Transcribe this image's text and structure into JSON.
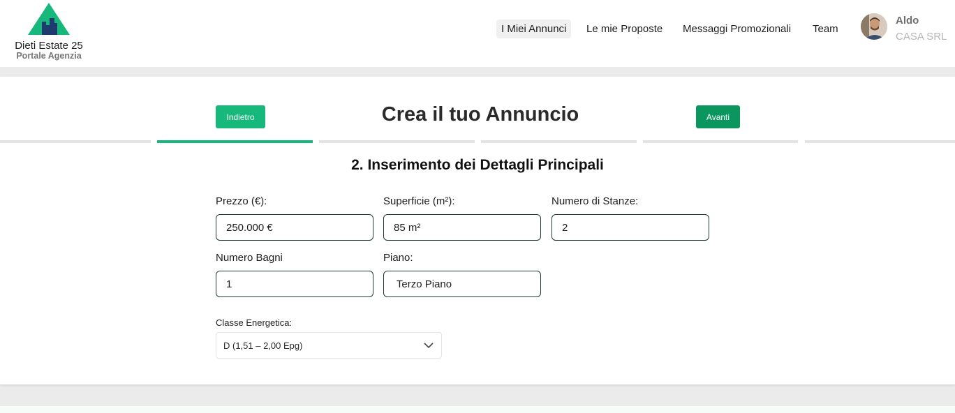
{
  "brand": {
    "name": "Dieti Estate 25",
    "subtitle": "Portale Agenzia",
    "colors": {
      "primary": "#16b87c",
      "primary_dark": "#0b9660",
      "building": "#1f3a6e"
    }
  },
  "nav": {
    "items": [
      {
        "label": "I Miei Annunci",
        "active": true
      },
      {
        "label": "Le mie Proposte",
        "active": false
      },
      {
        "label": "Messaggi Promozionali",
        "active": false
      },
      {
        "label": "Team",
        "active": false
      }
    ]
  },
  "user": {
    "name": "Aldo",
    "company": "CASA SRL"
  },
  "wizard": {
    "title": "Crea il tuo Annuncio",
    "back_label": "Indietro",
    "next_label": "Avanti",
    "current_step": 2,
    "total_steps": 6,
    "step_title": "2. Inserimento dei Dettagli Principali"
  },
  "form": {
    "price": {
      "label": "Prezzo (€):",
      "value": "250.000 €"
    },
    "surface": {
      "label": "Superficie (m²):",
      "value": "85 m²"
    },
    "rooms": {
      "label": "Numero di Stanze:",
      "value": "2"
    },
    "bathrooms": {
      "label": "Numero Bagni",
      "value": "1"
    },
    "floor": {
      "label": "Piano:",
      "value": " Terzo Piano"
    },
    "energy_class": {
      "label": "Classe Energetica:",
      "value": "D  (1,51 – 2,00 Epg)",
      "icon": "chevron-down-icon"
    }
  }
}
